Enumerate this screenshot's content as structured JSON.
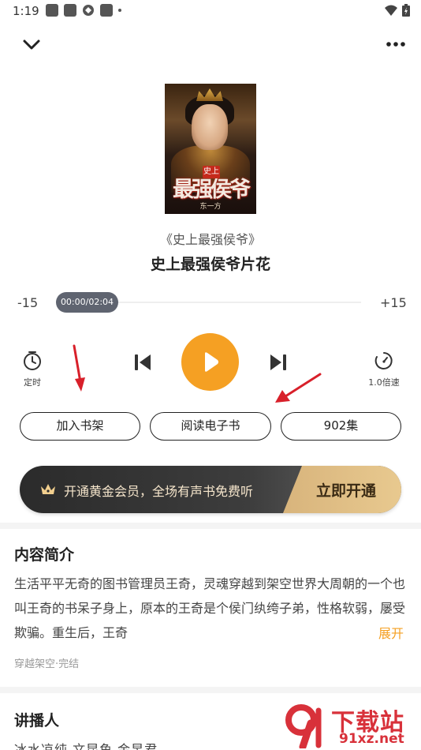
{
  "status_bar": {
    "time": "1:19"
  },
  "book": {
    "cover_title_art": "最强侯爷",
    "cover_badge": "史上",
    "cover_author": "东一方",
    "name": "《史上最强侯爷》",
    "episode_title": "史上最强侯爷片花"
  },
  "player": {
    "seek_back": "-15",
    "seek_forward": "+15",
    "time_readout": "00:00/02:04",
    "progress": 0,
    "timer_label": "定时",
    "speed_label": "1.0倍速"
  },
  "actions": {
    "add_shelf": "加入书架",
    "read_ebook": "阅读电子书",
    "episodes": "902集"
  },
  "vip": {
    "text": "开通黄金会员，全场有声书免费听",
    "cta": "立即开通"
  },
  "intro": {
    "title": "内容简介",
    "body": "生活平平无奇的图书管理员王奇，灵魂穿越到架空世界大周朝的一个也叫王奇的书呆子身上，原本的王奇是个侯门纨绔子弟，性格软弱，屡受欺骗。重生后，王奇",
    "expand": "展开",
    "tags": "穿越架空·完结"
  },
  "narrator": {
    "title": "讲播人",
    "names": "冰水凉纯 文昆鱼 金昱君"
  },
  "watermark": {
    "brand": "下载站",
    "domain": "91xz.net"
  },
  "colors": {
    "accent": "#f5a023",
    "vip_dark": "#2b2b2b",
    "vip_gold": "#d8b47c",
    "annotation_arrow": "#d8202a"
  }
}
